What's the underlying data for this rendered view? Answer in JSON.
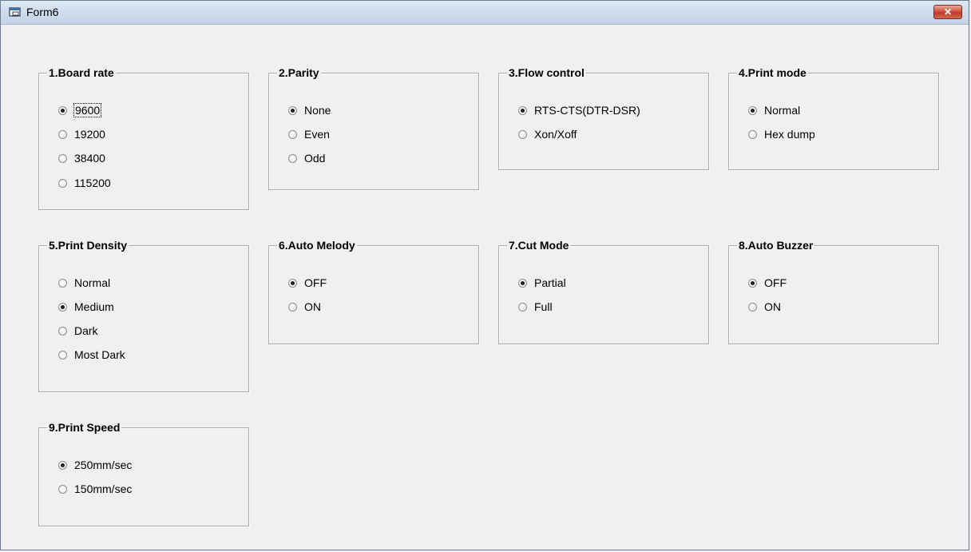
{
  "window": {
    "title": "Form6",
    "close_label": "✕"
  },
  "groups": [
    {
      "title": "1.Board rate",
      "options": [
        "9600",
        "19200",
        "38400",
        "115200"
      ],
      "selected": 0
    },
    {
      "title": "2.Parity",
      "options": [
        "None",
        "Even",
        "Odd"
      ],
      "selected": 0
    },
    {
      "title": "3.Flow control",
      "options": [
        "RTS-CTS(DTR-DSR)",
        "Xon/Xoff"
      ],
      "selected": 0
    },
    {
      "title": "4.Print mode",
      "options": [
        "Normal",
        "Hex dump"
      ],
      "selected": 0
    },
    {
      "title": "5.Print Density",
      "options": [
        "Normal",
        "Medium",
        "Dark",
        "Most Dark"
      ],
      "selected": 1
    },
    {
      "title": "6.Auto Melody",
      "options": [
        "OFF",
        "ON"
      ],
      "selected": 0
    },
    {
      "title": "7.Cut Mode",
      "options": [
        "Partial",
        "Full"
      ],
      "selected": 0
    },
    {
      "title": "8.Auto Buzzer",
      "options": [
        "OFF",
        "ON"
      ],
      "selected": 0
    },
    {
      "title": "9.Print Speed",
      "options": [
        "250mm/sec",
        "150mm/sec"
      ],
      "selected": 0
    }
  ]
}
